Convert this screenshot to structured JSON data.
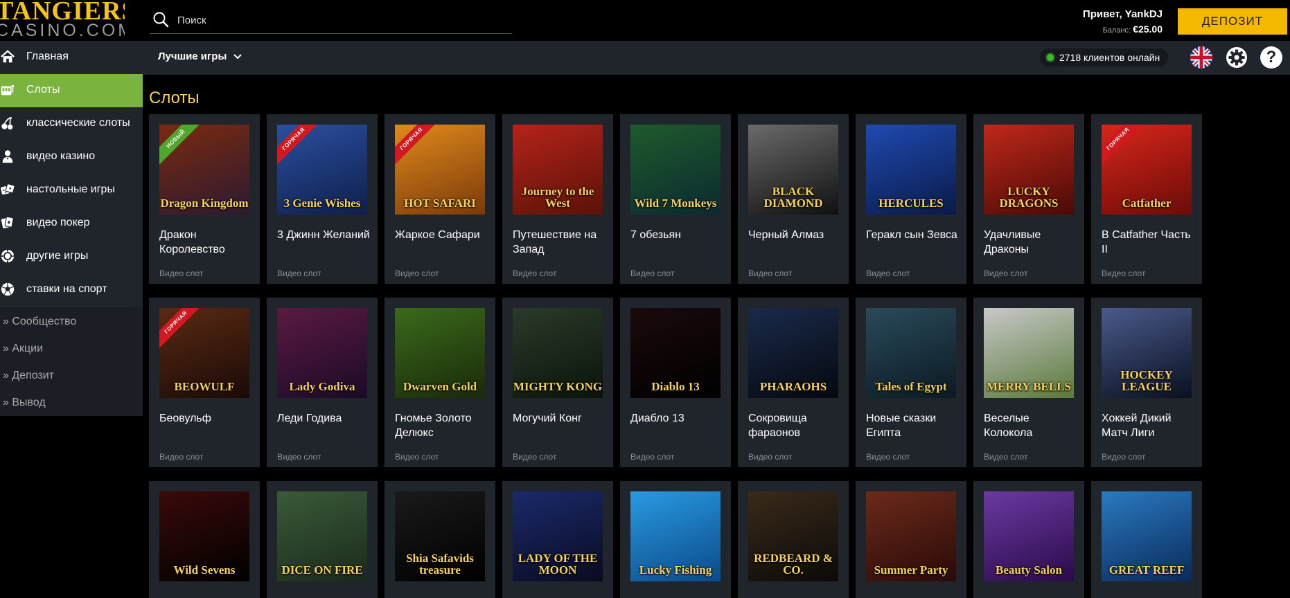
{
  "header": {
    "logo_top": "TANGIERS",
    "logo_bottom": "CASINO.COM",
    "search_placeholder": "Поиск",
    "greeting": "Привет, YankDJ",
    "balance_label": "Баланс:",
    "balance_value": "€25.00",
    "deposit_button": "ДЕПОЗИТ"
  },
  "subbar": {
    "best_games": "Лучшие игры",
    "online_text": "2718 клиентов онлайн"
  },
  "sidebar": {
    "items": [
      {
        "label": "Главная",
        "icon": "home-icon"
      },
      {
        "label": "Слоты",
        "icon": "slot-machine-icon",
        "active": true
      },
      {
        "label": "классические слоты",
        "icon": "cherries-icon"
      },
      {
        "label": "видео казино",
        "icon": "dealer-icon"
      },
      {
        "label": "настольные игры",
        "icon": "dice-icon"
      },
      {
        "label": "видео покер",
        "icon": "cards-icon"
      },
      {
        "label": "другие игры",
        "icon": "chip-icon"
      },
      {
        "label": "ставки на спорт",
        "icon": "soccer-ball-icon"
      }
    ],
    "secondary": [
      {
        "label": "Сообщество"
      },
      {
        "label": "Акции"
      },
      {
        "label": "Депозит"
      },
      {
        "label": "Вывод"
      }
    ]
  },
  "main": {
    "section_title": "Слоты",
    "card_type_label": "Видео слот",
    "rows": [
      [
        {
          "name": "Дракон Королевство",
          "art": "Dragon Kingdom",
          "badge": "НОВЫЙ",
          "badge_color": "#4fa82c",
          "bg": [
            "#7a2a10",
            "#2c1a30"
          ]
        },
        {
          "name": "3 Джинн Желаний",
          "art": "3 Genie Wishes",
          "badge": "ГОРЯЧАЯ",
          "badge_color": "#d1191f",
          "bg": [
            "#2b4fa0",
            "#0e1f4a"
          ]
        },
        {
          "name": "Жаркое Сафари",
          "art": "HOT SAFARI",
          "badge": "ГОРЯЧАЯ",
          "badge_color": "#d1191f",
          "bg": [
            "#e08a1c",
            "#7a3a0a"
          ]
        },
        {
          "name": "Путешествие на Запад",
          "art": "Journey to the West",
          "badge": "",
          "badge_color": "",
          "bg": [
            "#b4231a",
            "#5a1208"
          ]
        },
        {
          "name": "7 обезьян",
          "art": "Wild 7 Monkeys",
          "badge": "",
          "badge_color": "",
          "bg": [
            "#1f5a2c",
            "#0b2a30"
          ]
        },
        {
          "name": "Черный Алмаз",
          "art": "BLACK DIAMOND",
          "badge": "",
          "badge_color": "",
          "bg": [
            "#6a6a6a",
            "#101010"
          ]
        },
        {
          "name": "Геракл сын Зевса",
          "art": "HERCULES",
          "badge": "",
          "badge_color": "",
          "bg": [
            "#1f4ab0",
            "#0a1a48"
          ]
        },
        {
          "name": "Удачливые Драконы",
          "art": "LUCKY DRAGONS",
          "badge": "",
          "badge_color": "",
          "bg": [
            "#c0281a",
            "#4a0a06"
          ]
        },
        {
          "name": "В Catfather Часть II",
          "art": "Catfather",
          "badge": "ГОРЯЧАЯ",
          "badge_color": "#d1191f",
          "bg": [
            "#d8261a",
            "#6a0c08"
          ]
        }
      ],
      [
        {
          "name": "Беовульф",
          "art": "BEOWULF",
          "badge": "ГОРЯЧАЯ",
          "badge_color": "#d1191f",
          "bg": [
            "#5a2a12",
            "#1a0a08"
          ]
        },
        {
          "name": "Леди Годива",
          "art": "Lady Godiva",
          "badge": "",
          "badge_color": "",
          "bg": [
            "#5a1a40",
            "#1a0a28"
          ]
        },
        {
          "name": "Гномье Золото Делюкс",
          "art": "Dwarven Gold",
          "badge": "",
          "badge_color": "",
          "bg": [
            "#3a6a1a",
            "#1a2a0a"
          ]
        },
        {
          "name": "Могучий Конг",
          "art": "MIGHTY KONG",
          "badge": "",
          "badge_color": "",
          "bg": [
            "#2a3a2a",
            "#0a140a"
          ]
        },
        {
          "name": "Диабло 13",
          "art": "Diablo 13",
          "badge": "",
          "badge_color": "",
          "bg": [
            "#1a0a0a",
            "#000000"
          ]
        },
        {
          "name": "Сокровища фараонов",
          "art": "PHARAOHS",
          "badge": "",
          "badge_color": "",
          "bg": [
            "#1a2a4a",
            "#05080f"
          ]
        },
        {
          "name": "Новые сказки Египта",
          "art": "Tales of Egypt",
          "badge": "",
          "badge_color": "",
          "bg": [
            "#2a4a5a",
            "#0a1a22"
          ]
        },
        {
          "name": "Веселые Колокола",
          "art": "MERRY BELLS",
          "badge": "",
          "badge_color": "",
          "bg": [
            "#c8c8c8",
            "#5a7a3a"
          ]
        },
        {
          "name": "Хоккей Дикий Матч Лиги",
          "art": "HOCKEY LEAGUE",
          "badge": "",
          "badge_color": "",
          "bg": [
            "#4a5a8a",
            "#0a1020"
          ]
        }
      ],
      [
        {
          "name": "",
          "art": "Wild Sevens",
          "badge": "",
          "badge_color": "",
          "bg": [
            "#3a0a0a",
            "#000000"
          ]
        },
        {
          "name": "",
          "art": "DICE ON FIRE",
          "badge": "",
          "badge_color": "",
          "bg": [
            "#3a5a3a",
            "#1a2a1a"
          ]
        },
        {
          "name": "",
          "art": "Shia Safavids treasure",
          "badge": "",
          "badge_color": "",
          "bg": [
            "#1a1a1a",
            "#000000"
          ]
        },
        {
          "name": "",
          "art": "LADY OF THE MOON",
          "badge": "",
          "badge_color": "",
          "bg": [
            "#1a2a6a",
            "#0a0a20"
          ]
        },
        {
          "name": "",
          "art": "Lucky Fishing",
          "badge": "",
          "badge_color": "",
          "bg": [
            "#2a9ae0",
            "#0a4a8a"
          ]
        },
        {
          "name": "",
          "art": "REDBEARD & CO.",
          "badge": "",
          "badge_color": "",
          "bg": [
            "#3a2a1a",
            "#0a0a08"
          ]
        },
        {
          "name": "",
          "art": "Summer Party",
          "badge": "",
          "badge_color": "",
          "bg": [
            "#6a2a1a",
            "#2a0a08"
          ]
        },
        {
          "name": "",
          "art": "Beauty Salon",
          "badge": "",
          "badge_color": "",
          "bg": [
            "#6a3aa0",
            "#2a0a4a"
          ]
        },
        {
          "name": "",
          "art": "GREAT REEF",
          "badge": "",
          "badge_color": "",
          "bg": [
            "#2a7ac0",
            "#0a2a5a"
          ]
        }
      ]
    ]
  },
  "colors": {
    "accent_green": "#7ab33d",
    "deposit_yellow": "#f5b800",
    "title_gold": "#f6cf55",
    "panel": "#20242b"
  }
}
